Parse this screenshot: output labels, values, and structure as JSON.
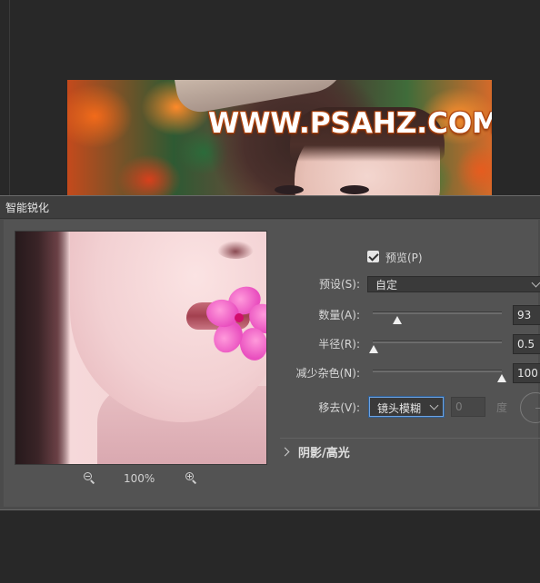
{
  "canvas": {
    "watermark": "WWW.PSAHZ.COM"
  },
  "dialog": {
    "title": "智能锐化",
    "preview_checkbox_label": "预览(P)",
    "preview_checked": true,
    "preset_label": "预设(S):",
    "preset_value": "自定",
    "amount_label": "数量(A):",
    "amount_value": "93",
    "amount_fraction": 0.19,
    "radius_label": "半径(R):",
    "radius_value": "0.5",
    "radius_fraction": 0.01,
    "noise_label": "减少杂色(N):",
    "noise_value": "100",
    "noise_fraction": 1.0,
    "remove_label": "移去(V):",
    "remove_value": "镜头模糊",
    "angle_value": "0",
    "angle_unit": "度",
    "section_label": "阴影/高光",
    "zoom_pct": "100%"
  },
  "colors": {
    "dialog_bg": "#535353",
    "focus_ring": "#6fa3e0"
  },
  "icons": [
    "zoom-out-icon",
    "zoom-in-icon",
    "chevron-down-icon",
    "chevron-right-icon",
    "checkmark-icon",
    "angle-dial-icon"
  ]
}
